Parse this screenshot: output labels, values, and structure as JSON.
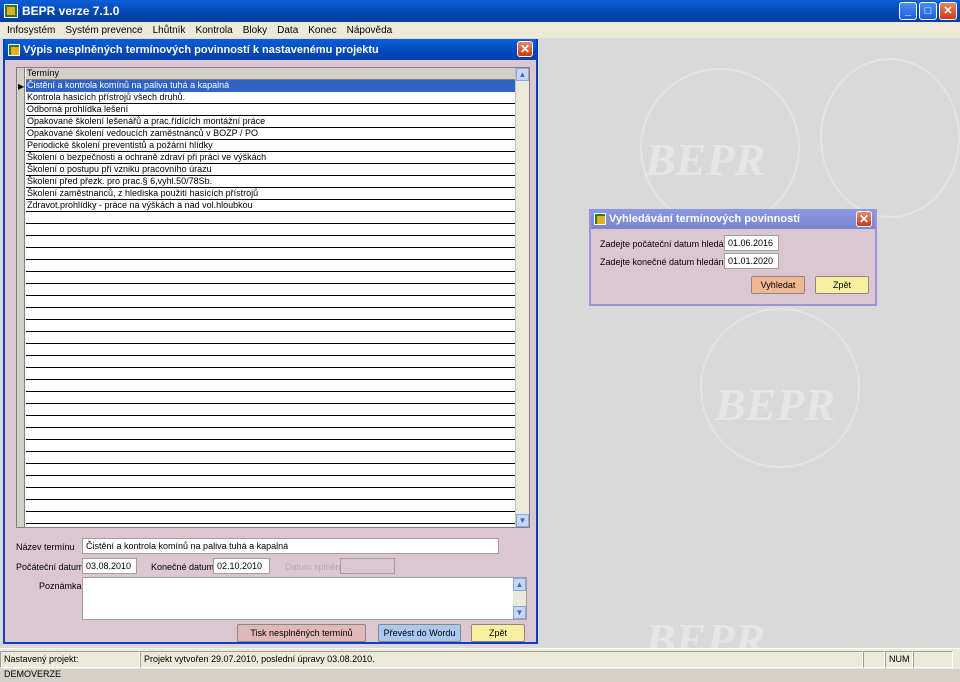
{
  "app": {
    "title": "BEPR verze 7.1.0",
    "window_controls": [
      "minimize-icon",
      "maximize-icon",
      "close-icon"
    ]
  },
  "menu": [
    "Infosystém",
    "Systém prevence",
    "Lhůtník",
    "Kontrola",
    "Bloky",
    "Data",
    "Konec",
    "Nápověda"
  ],
  "main_window": {
    "title": "Výpis nesplněných termínových povinností k nastavenému projektu",
    "grid": {
      "column": "Termíny",
      "rows": [
        "Čistění a kontrola komínů na paliva tuhá a kapalná",
        "Kontrola hasicích přístrojů všech druhů.",
        "Odborná prohlídka lešení",
        "Opakované školení lešenářů a prac.řídících montážní práce",
        "Opakované školení vedoucích zaměstnanců v BOZP / PO",
        "Periodické školení preventistů a požární hlídky",
        "Školení o bezpečnosti a ochraně zdraví při práci ve výškách",
        "Školení o postupu při vzniku pracovního úrazu",
        "Školení před přezk. pro prac.§ 6,vyhl.50/78Sb.",
        "Školení zaměstnanců, z hlediska použití hasících přístrojů",
        "Zdravot.prohlídky - práce na výškách a nad vol.hloubkou"
      ]
    },
    "nazev_label": "Název termínu",
    "nazev_value": "Čistění a kontrola komínů na paliva tuhá a kapalná",
    "pocatecni_label": "Počáteční datum",
    "pocatecni_value": "03.08.2010",
    "konecne_label": "Konečné datum",
    "konecne_value": "02.10.2010",
    "splneni_label": "Datum splnění",
    "splneni_value": "  .  .",
    "poznamka_label": "Poznámka",
    "poznamka_value": "",
    "btn_tisk": "Tisk nesplněných termínů",
    "btn_word": "Převést do Wordu",
    "btn_zpet": "Zpět"
  },
  "dialog": {
    "title": "Vyhledávání termínových povinností",
    "start_label": "Zadejte počáteční datum hledání",
    "start_value": "01.06.2016",
    "end_label": "Zadejte konečné datum hledání",
    "end_value": "01.01.2020",
    "btn_search": "Vyhledat",
    "btn_back": "Zpět"
  },
  "watermark": "BEPR",
  "status": {
    "project": "Nastavený projekt: DEMOVERZE",
    "created": "Projekt vytvořen 29.07.2010, poslední úpravy 03.08.2010.",
    "num": "NUM"
  },
  "colors": {
    "window_bg": "#dcc6d2",
    "selection": "#2f63c8",
    "btn_pink": "#e0b8b8",
    "btn_blue": "#a8c8f0",
    "btn_yellow": "#f8f0a0",
    "btn_orange": "#f0b890"
  }
}
